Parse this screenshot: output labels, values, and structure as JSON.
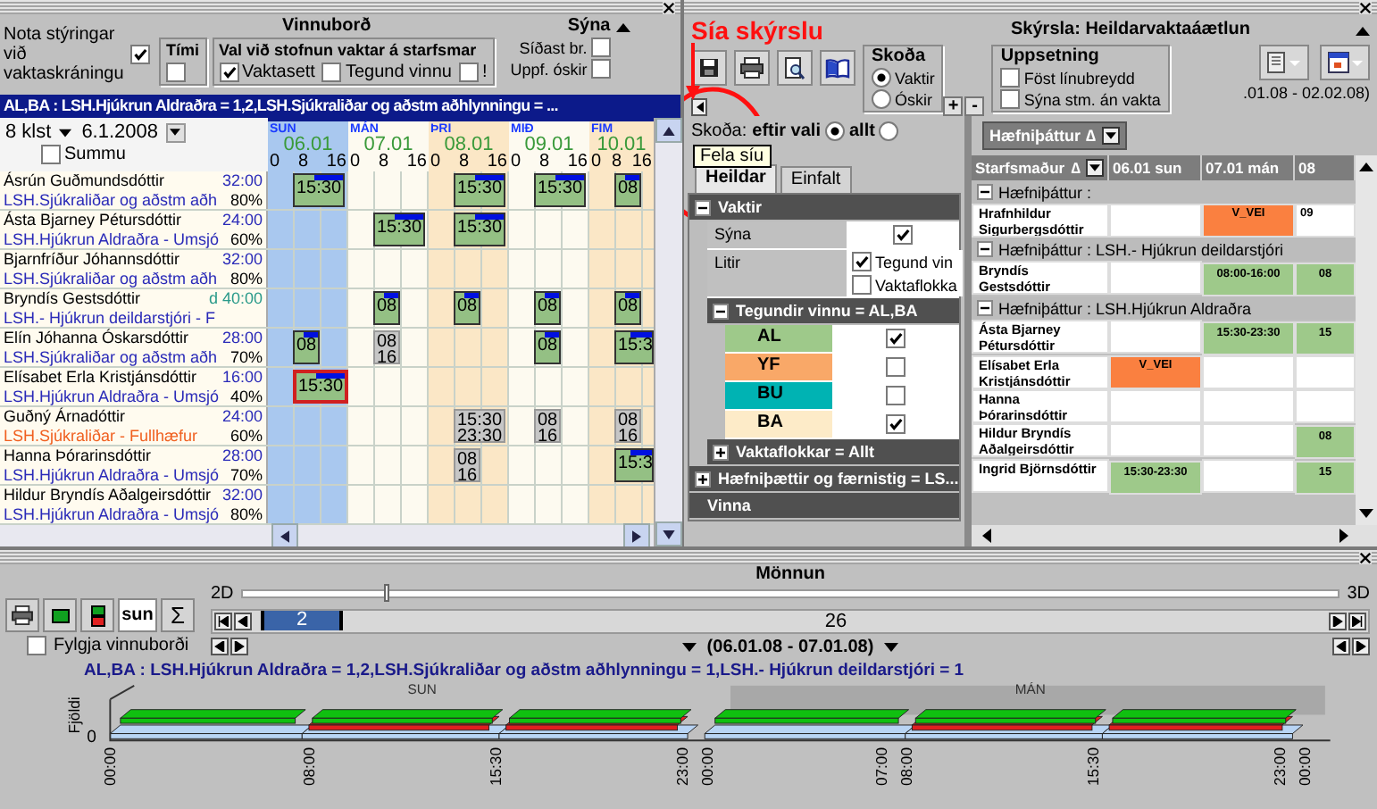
{
  "workboard": {
    "title": "Vinnuborð",
    "use_controls": {
      "label": "Nota stýringar við vaktaskráningu",
      "checked": true
    },
    "time_group": {
      "title": "Tími",
      "checked": false
    },
    "shift_group": {
      "title": "Val við stofnun vaktar á starfsmar",
      "options": [
        {
          "label": "Vaktasett",
          "checked": true
        },
        {
          "label": "Tegund vinnu",
          "checked": false
        },
        {
          "label": "!",
          "checked": false
        }
      ]
    },
    "show_group": {
      "title": "Sýna",
      "options": [
        {
          "label": "Síðast br.",
          "checked": false
        },
        {
          "label": "Uppf. óskir",
          "checked": false
        }
      ]
    },
    "filter_bar": "AL,BA : LSH.Hjúkrun Aldraðra = 1,2,LSH.Sjúkraliðar og aðstm aðhlynningu = ...",
    "interval": "8 klst",
    "date": "6.1.2008",
    "sums": {
      "label": "Summu",
      "checked": false
    },
    "days": [
      {
        "weekday": "SUN",
        "date": "06.01",
        "weekend": true,
        "ticks": [
          "0",
          "8",
          "16"
        ]
      },
      {
        "weekday": "MÁN",
        "date": "07.01",
        "weekend": false,
        "ticks": [
          "0",
          "8",
          "16"
        ]
      },
      {
        "weekday": "ÞRI",
        "date": "08.01",
        "weekend": false,
        "ticks": [
          "0",
          "8",
          "16"
        ]
      },
      {
        "weekday": "MIÐ",
        "date": "09.01",
        "weekend": false,
        "ticks": [
          "0",
          "8",
          "16"
        ]
      },
      {
        "weekday": "FIM",
        "date": "10.01",
        "weekend": false,
        "ticks": [
          "0",
          "8",
          "16"
        ]
      }
    ],
    "employees": [
      {
        "name": "Ásrún Guðmundsdóttir",
        "hours": "32:00",
        "hours_marked": false,
        "group": "LSH.Sjúkraliðar og aðstm aðh",
        "group_highlight": false,
        "percent": "80%",
        "day_cells": [
          {
            "kind": "shift",
            "lines": [
              "15:30"
            ],
            "confirmed": true,
            "flagged": false
          },
          {
            "kind": "empty"
          },
          {
            "kind": "shift",
            "lines": [
              "15:30"
            ],
            "confirmed": true,
            "flagged": false
          },
          {
            "kind": "shift",
            "lines": [
              "15:30"
            ],
            "confirmed": true,
            "flagged": false
          },
          {
            "kind": "shift",
            "lines": [
              "08"
            ],
            "confirmed": true,
            "flagged": false
          }
        ]
      },
      {
        "name": "Ásta Bjarney Pétursdóttir",
        "hours": "24:00",
        "hours_marked": false,
        "group": "LSH.Hjúkrun Aldraðra - Umsjó",
        "group_highlight": false,
        "percent": "60%",
        "day_cells": [
          {
            "kind": "empty"
          },
          {
            "kind": "shift",
            "lines": [
              "15:30"
            ],
            "confirmed": true,
            "flagged": false
          },
          {
            "kind": "shift",
            "lines": [
              "15:30"
            ],
            "confirmed": true,
            "flagged": false
          },
          {
            "kind": "empty"
          },
          {
            "kind": "empty"
          }
        ]
      },
      {
        "name": "Bjarnfríður Jóhannsdóttir",
        "hours": "32:00",
        "hours_marked": false,
        "group": "LSH.Sjúkraliðar og aðstm aðh",
        "group_highlight": false,
        "percent": "80%",
        "day_cells": [
          {
            "kind": "empty"
          },
          {
            "kind": "empty"
          },
          {
            "kind": "empty"
          },
          {
            "kind": "empty"
          },
          {
            "kind": "empty"
          }
        ]
      },
      {
        "name": "Bryndís Gestsdóttir",
        "hours": "d 40:00",
        "hours_marked": true,
        "group": "LSH.- Hjúkrun deildarstjóri - F",
        "group_highlight": false,
        "day_cells": [
          {
            "kind": "empty"
          },
          {
            "kind": "shift",
            "lines": [
              "08"
            ],
            "confirmed": true,
            "flagged": false
          },
          {
            "kind": "shift",
            "lines": [
              "08"
            ],
            "confirmed": true,
            "flagged": false
          },
          {
            "kind": "shift",
            "lines": [
              "08"
            ],
            "confirmed": true,
            "flagged": false
          },
          {
            "kind": "shift",
            "lines": [
              "08"
            ],
            "confirmed": true,
            "flagged": false
          }
        ]
      },
      {
        "name": "Elín Jóhanna Óskarsdóttir",
        "hours": "28:00",
        "hours_marked": false,
        "group": "LSH.Sjúkraliðar og aðstm aðh",
        "group_highlight": false,
        "percent": "70%",
        "day_cells": [
          {
            "kind": "shift",
            "lines": [
              "08"
            ],
            "confirmed": true,
            "flagged": false
          },
          {
            "kind": "shift",
            "lines": [
              "08",
              "16"
            ],
            "confirmed": false,
            "flagged": false
          },
          {
            "kind": "empty"
          },
          {
            "kind": "shift",
            "lines": [
              "08"
            ],
            "confirmed": true,
            "flagged": false
          },
          {
            "kind": "shift",
            "lines": [
              "15:3"
            ],
            "confirmed": true,
            "flagged": false
          }
        ]
      },
      {
        "name": "Elísabet Erla Kristjánsdóttir",
        "hours": "16:00",
        "hours_marked": false,
        "group": "LSH.Hjúkrun Aldraðra - Umsjó",
        "group_highlight": false,
        "percent": "40%",
        "day_cells": [
          {
            "kind": "shift",
            "lines": [
              "15:30"
            ],
            "confirmed": true,
            "flagged": true
          },
          {
            "kind": "empty"
          },
          {
            "kind": "empty"
          },
          {
            "kind": "empty"
          },
          {
            "kind": "empty"
          }
        ]
      },
      {
        "name": "Guðný Árnadóttir",
        "hours": "24:00",
        "hours_marked": false,
        "group": "LSH.Sjúkraliðar - Fullhæfur",
        "group_highlight": true,
        "percent": "60%",
        "day_cells": [
          {
            "kind": "empty"
          },
          {
            "kind": "empty"
          },
          {
            "kind": "shift",
            "lines": [
              "15:30",
              "23:30"
            ],
            "confirmed": false,
            "flagged": false
          },
          {
            "kind": "shift",
            "lines": [
              "08",
              "16"
            ],
            "confirmed": false,
            "flagged": false
          },
          {
            "kind": "shift",
            "lines": [
              "08",
              "16"
            ],
            "confirmed": false,
            "flagged": false
          }
        ]
      },
      {
        "name": "Hanna Þórarinsdóttir",
        "hours": "28:00",
        "hours_marked": false,
        "group": "LSH.Hjúkrun Aldraðra - Umsjó",
        "group_highlight": false,
        "percent": "70%",
        "day_cells": [
          {
            "kind": "empty"
          },
          {
            "kind": "empty"
          },
          {
            "kind": "shift",
            "lines": [
              "08",
              "16"
            ],
            "confirmed": false,
            "flagged": false
          },
          {
            "kind": "empty"
          },
          {
            "kind": "shift",
            "lines": [
              "15:3"
            ],
            "confirmed": true,
            "flagged": false
          }
        ]
      },
      {
        "name": "Hildur Bryndís Aðalgeirsdóttir",
        "hours": "32:00",
        "hours_marked": false,
        "group": "LSH.Hjúkrun Aldraðra - Umsjó",
        "group_highlight": false,
        "percent": "80%",
        "day_cells": [
          {
            "kind": "empty"
          },
          {
            "kind": "empty"
          },
          {
            "kind": "empty"
          },
          {
            "kind": "empty"
          },
          {
            "kind": "empty"
          }
        ]
      }
    ]
  },
  "report": {
    "annotation": "Sía skýrslu",
    "title": "Skýrsla: Heildarvaktaáætlun",
    "view_group": {
      "title": "Skoða",
      "options": [
        {
          "label": "Vaktir",
          "selected": true
        },
        {
          "label": "Óskir",
          "selected": false
        }
      ]
    },
    "layout_group": {
      "title": "Uppsetning",
      "options": [
        {
          "label": "Föst línubreydd",
          "checked": false
        },
        {
          "label": "Sýna stm. án vakta",
          "checked": false
        }
      ]
    },
    "zoom_in": "+",
    "zoom_out": "-",
    "date_range": ".01.08 - 02.02.08)",
    "scope": {
      "label": "Skoða:",
      "options": [
        {
          "label": "eftir vali",
          "selected": true
        },
        {
          "label": "allt",
          "selected": false
        }
      ]
    },
    "tooltip": "Fela síu",
    "tabs": [
      {
        "label": "Heildar",
        "selected": true
      },
      {
        "label": "Einfalt",
        "selected": false
      }
    ],
    "filter_tree": [
      {
        "kind": "section",
        "label": "Vaktir",
        "expanded": true,
        "children": [
          {
            "kind": "check",
            "label": "Sýna",
            "checked": true
          },
          {
            "kind": "multi",
            "label": "Litir",
            "options": [
              {
                "label": "Tegund vin",
                "checked": true
              },
              {
                "label": "Vaktaflokka",
                "checked": false
              }
            ]
          },
          {
            "kind": "group",
            "label": "Tegundir vinnu = AL,BA",
            "expanded": true,
            "children": [
              {
                "label": "AL",
                "color": "#9ec98a",
                "checked": true
              },
              {
                "label": "YF",
                "color": "#f9a868",
                "checked": false
              },
              {
                "label": "BU",
                "color": "#00b3b3",
                "checked": false
              },
              {
                "label": "BA",
                "color": "#fdebc8",
                "checked": true
              }
            ]
          },
          {
            "kind": "group",
            "label": "Vaktaflokkar = Allt",
            "expanded": false
          }
        ]
      },
      {
        "kind": "section",
        "label": "Hæfniþættir og færnistig = LS...",
        "expanded": false
      },
      {
        "kind": "plain",
        "label": "Vinna"
      }
    ],
    "grid": {
      "group_by": "Hæfniþáttur",
      "sort_mark": "∆",
      "columns": [
        "Starfsmaður",
        "06.01 sun",
        "07.01 mán",
        "08"
      ],
      "groups": [
        {
          "label": "Hæfniþáttur :",
          "expanded": true,
          "rows": [
            {
              "name": "Hrafnhildur Sigurbergsdóttir",
              "cells": [
                {
                  "kind": "empty"
                },
                {
                  "kind": "absence",
                  "text": "V_VEI"
                },
                {
                  "kind": "text",
                  "text": "09"
                }
              ]
            }
          ]
        },
        {
          "label": "Hæfniþáttur : LSH.- Hjúkrun deildarstjóri",
          "expanded": true,
          "rows": [
            {
              "name": "Bryndís Gestsdóttir",
              "cells": [
                {
                  "kind": "empty"
                },
                {
                  "kind": "shift",
                  "text": "08:00-16:00"
                },
                {
                  "kind": "shift",
                  "text": "08"
                }
              ]
            }
          ]
        },
        {
          "label": "Hæfniþáttur : LSH.Hjúkrun Aldraðra",
          "expanded": true,
          "rows": [
            {
              "name": "Ásta Bjarney Pétursdóttir",
              "cells": [
                {
                  "kind": "empty"
                },
                {
                  "kind": "shift",
                  "text": "15:30-23:30"
                },
                {
                  "kind": "shift",
                  "text": "15"
                }
              ]
            },
            {
              "name": "Elísabet Erla Kristjánsdóttir",
              "cells": [
                {
                  "kind": "absence",
                  "text": "V_VEI"
                },
                {
                  "kind": "empty"
                },
                {
                  "kind": "empty"
                }
              ]
            },
            {
              "name": "Hanna Þórarinsdóttir",
              "cells": [
                {
                  "kind": "empty"
                },
                {
                  "kind": "empty"
                },
                {
                  "kind": "empty"
                }
              ]
            },
            {
              "name": "Hildur Bryndís Aðalgeirsdóttir",
              "cells": [
                {
                  "kind": "empty"
                },
                {
                  "kind": "empty"
                },
                {
                  "kind": "shift",
                  "text": "08"
                }
              ]
            },
            {
              "name": "Ingrid Björnsdóttir",
              "cells": [
                {
                  "kind": "shift",
                  "text": "15:30-23:30"
                },
                {
                  "kind": "empty"
                },
                {
                  "kind": "shift",
                  "text": "15"
                }
              ]
            }
          ]
        }
      ]
    }
  },
  "staffing": {
    "title": "Mönnun",
    "day_toggle": {
      "label": "sun",
      "selected": true
    },
    "sum_button": "Σ",
    "follow": {
      "label": "Fylgja vinnuborði",
      "checked": false
    },
    "depth": {
      "min_label": "2D",
      "max_label": "3D",
      "level": 0.13
    },
    "pager": {
      "current": "2",
      "total": "26"
    },
    "period": "(06.01.08 - 07.01.08)",
    "chart_title": "AL,BA : LSH.Hjúkrun Aldraðra = 1,2,LSH.Sjúkraliðar og aðstm aðhlynningu = 1,LSH.- Hjúkrun deildarstjóri = 1",
    "chart": {
      "ylabel": "Fjöldi",
      "y_tick": "0",
      "day_labels": [
        "SUN",
        "MÁN"
      ],
      "x_ticks": [
        "00:00",
        "08:00",
        "15:30",
        "23:00",
        "00:00",
        "07:00",
        "08:00",
        "15:30",
        "23:00",
        "00:00"
      ]
    }
  }
}
